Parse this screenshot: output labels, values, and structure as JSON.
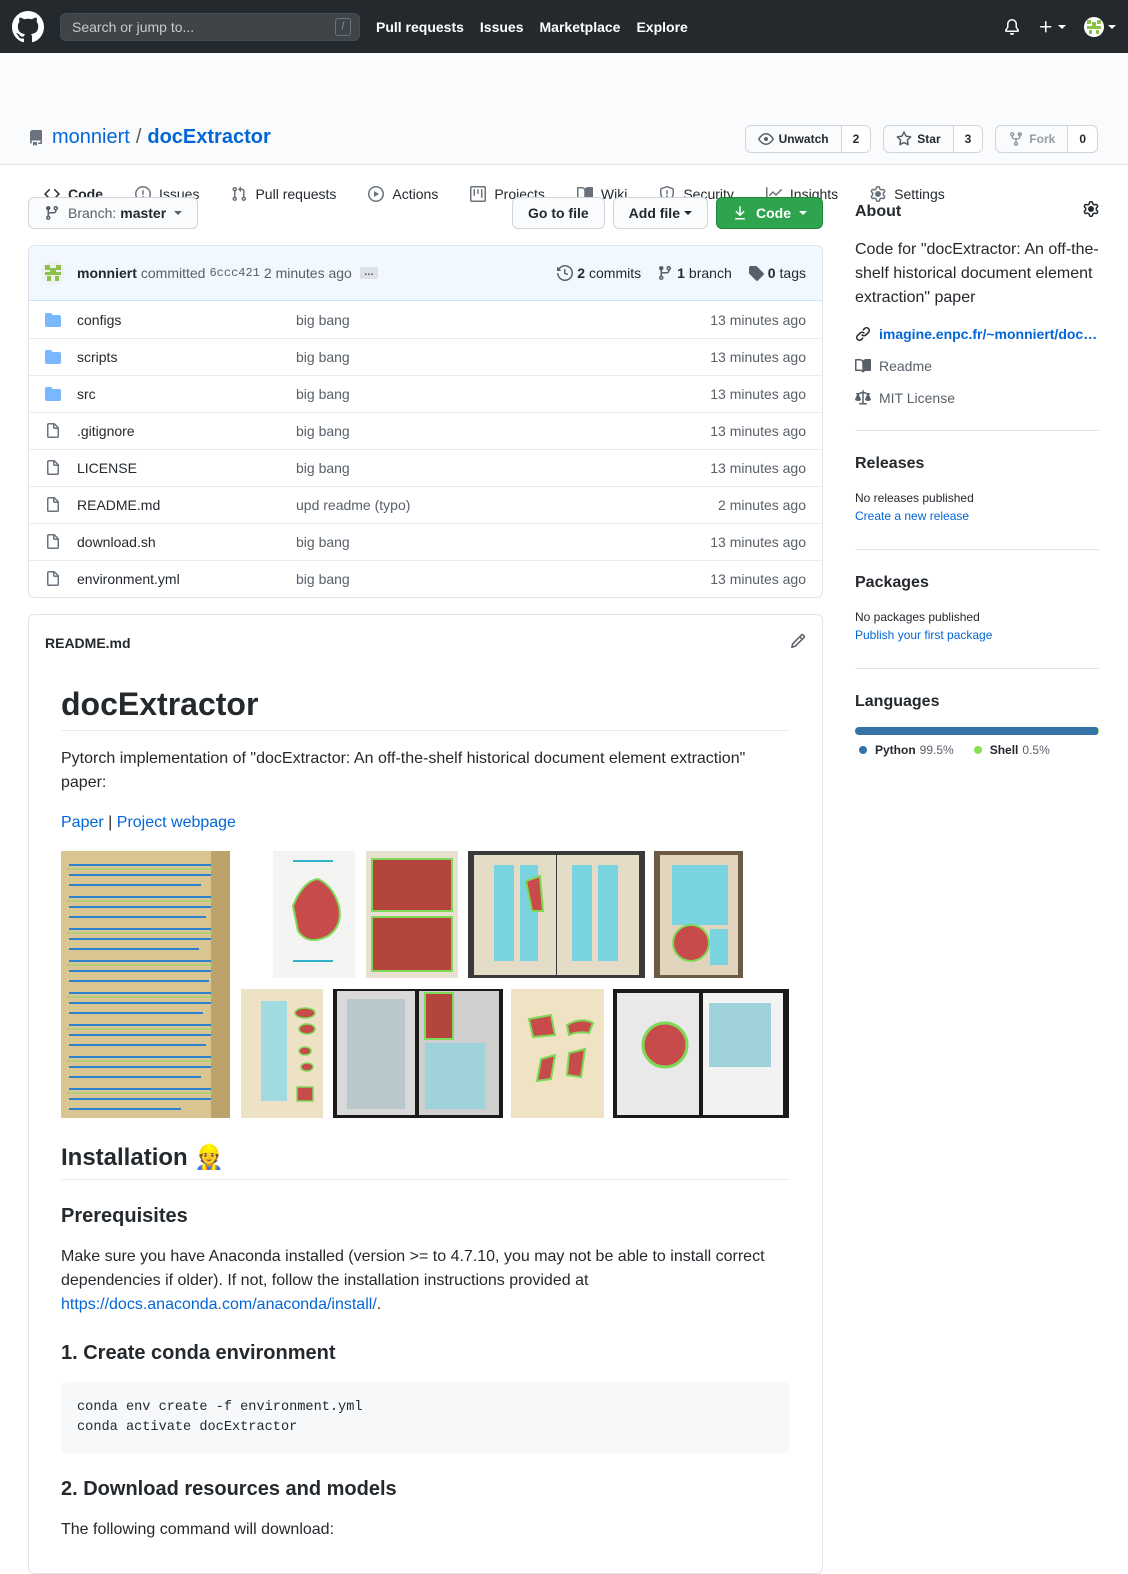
{
  "header": {
    "search_placeholder": "Search or jump to...",
    "search_shortcut": "/",
    "nav": [
      "Pull requests",
      "Issues",
      "Marketplace",
      "Explore"
    ]
  },
  "repo": {
    "owner": "monniert",
    "separator": "/",
    "name": "docExtractor",
    "watch": {
      "label": "Unwatch",
      "count": "2"
    },
    "star": {
      "label": "Star",
      "count": "3"
    },
    "fork": {
      "label": "Fork",
      "count": "0"
    },
    "tabs": [
      {
        "label": "Code",
        "icon": "code-icon"
      },
      {
        "label": "Issues",
        "icon": "issue-icon"
      },
      {
        "label": "Pull requests",
        "icon": "pull-request-icon"
      },
      {
        "label": "Actions",
        "icon": "play-icon"
      },
      {
        "label": "Projects",
        "icon": "project-icon"
      },
      {
        "label": "Wiki",
        "icon": "book-icon"
      },
      {
        "label": "Security",
        "icon": "shield-icon"
      },
      {
        "label": "Insights",
        "icon": "graph-icon"
      },
      {
        "label": "Settings",
        "icon": "gear-icon"
      }
    ]
  },
  "toolbar": {
    "branch_prefix": "Branch:",
    "branch": "master",
    "go_to_file": "Go to file",
    "add_file": "Add file",
    "code": "Code"
  },
  "commit": {
    "author": "monniert",
    "verb": "committed",
    "sha": "6ccc421",
    "ago": "2 minutes ago",
    "dots": "…",
    "commits_count": "2",
    "commits_label": "commits",
    "branch_count": "1",
    "branch_label": "branch",
    "tags_count": "0",
    "tags_label": "tags"
  },
  "files": [
    {
      "name": "configs",
      "type": "dir",
      "message": "big bang",
      "age": "13 minutes ago"
    },
    {
      "name": "scripts",
      "type": "dir",
      "message": "big bang",
      "age": "13 minutes ago"
    },
    {
      "name": "src",
      "type": "dir",
      "message": "big bang",
      "age": "13 minutes ago"
    },
    {
      "name": ".gitignore",
      "type": "file",
      "message": "big bang",
      "age": "13 minutes ago"
    },
    {
      "name": "LICENSE",
      "type": "file",
      "message": "big bang",
      "age": "13 minutes ago"
    },
    {
      "name": "README.md",
      "type": "file",
      "message": "upd readme (typo)",
      "age": "2 minutes ago"
    },
    {
      "name": "download.sh",
      "type": "file",
      "message": "big bang",
      "age": "13 minutes ago"
    },
    {
      "name": "environment.yml",
      "type": "file",
      "message": "big bang",
      "age": "13 minutes ago"
    }
  ],
  "readme": {
    "file_label": "README.md",
    "title": "docExtractor",
    "intro": "Pytorch implementation of \"docExtractor: An off-the-shelf historical document element extraction\" paper:",
    "link_paper": "Paper",
    "link_sep": "|",
    "link_project": "Project webpage",
    "installation": "Installation 👷",
    "prereq": "Prerequisites",
    "prereq_text": "Make sure you have Anaconda installed (version >= to 4.7.10, you may not be able to install correct dependencies if older). If not, follow the installation instructions provided at",
    "prereq_link": "https://docs.anaconda.com/anaconda/install/",
    "prereq_end": ".",
    "step1": "1. Create conda environment",
    "code1_line1": "conda env create -f environment.yml",
    "code1_line2": "conda activate docExtractor",
    "step2": "2. Download resources and models",
    "step2_text": "The following command will download:"
  },
  "sidebar": {
    "about_title": "About",
    "about_text": "Code for \"docExtractor: An off-the-shelf historical document element extraction\" paper",
    "website": "imagine.enpc.fr/~monniert/docExtractor",
    "readme": "Readme",
    "license": "MIT License",
    "releases_title": "Releases",
    "releases_none": "No releases published",
    "releases_link": "Create a new release",
    "packages_title": "Packages",
    "packages_none": "No packages published",
    "packages_link": "Publish your first package",
    "languages_title": "Languages",
    "languages": [
      {
        "name": "Python",
        "pct": "99.5%",
        "color": "#3572A5"
      },
      {
        "name": "Shell",
        "pct": "0.5%",
        "color": "#89e051"
      }
    ]
  }
}
